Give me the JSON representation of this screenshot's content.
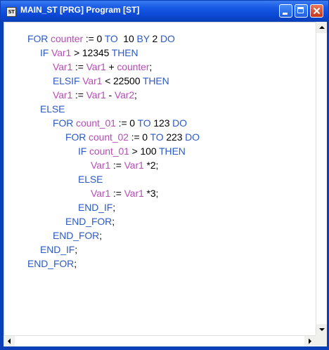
{
  "window": {
    "title": "MAIN_ST [PRG] Program [ST]",
    "icon_label": "ST",
    "icon": "st-program-icon",
    "controls": [
      "minimize-icon",
      "maximize-icon",
      "close-icon"
    ]
  },
  "colors": {
    "titlebar": "#0b47d4",
    "keyword": "#2c5ac4",
    "variable": "#b54eb5",
    "operator": "#000000",
    "close_button": "#c4371c"
  },
  "code": {
    "lines": [
      {
        "indent": 0,
        "tokens": [
          {
            "t": "kw",
            "v": "FOR "
          },
          {
            "t": "var",
            "v": "counter"
          },
          {
            "t": "op",
            "v": " := 0 "
          },
          {
            "t": "kw",
            "v": "TO"
          },
          {
            "t": "op",
            "v": "  10 "
          },
          {
            "t": "kw",
            "v": "BY"
          },
          {
            "t": "op",
            "v": " 2 "
          },
          {
            "t": "kw",
            "v": "DO"
          }
        ]
      },
      {
        "indent": 1,
        "tokens": [
          {
            "t": "kw",
            "v": "IF "
          },
          {
            "t": "var",
            "v": "Var1"
          },
          {
            "t": "op",
            "v": " > 12345 "
          },
          {
            "t": "kw",
            "v": "THEN"
          }
        ]
      },
      {
        "indent": 2,
        "tokens": [
          {
            "t": "var",
            "v": "Var1"
          },
          {
            "t": "op",
            "v": " := "
          },
          {
            "t": "var",
            "v": "Var1"
          },
          {
            "t": "op",
            "v": " + "
          },
          {
            "t": "var",
            "v": "counter"
          },
          {
            "t": "op",
            "v": ";"
          }
        ]
      },
      {
        "indent": 2,
        "tokens": [
          {
            "t": "kw",
            "v": "ELSIF "
          },
          {
            "t": "var",
            "v": "Var1"
          },
          {
            "t": "op",
            "v": " < 22500 "
          },
          {
            "t": "kw",
            "v": "THEN"
          }
        ]
      },
      {
        "indent": 2,
        "tokens": [
          {
            "t": "var",
            "v": "Var1"
          },
          {
            "t": "op",
            "v": " := "
          },
          {
            "t": "var",
            "v": "Var1"
          },
          {
            "t": "op",
            "v": " - "
          },
          {
            "t": "var",
            "v": "Var2"
          },
          {
            "t": "op",
            "v": ";"
          }
        ]
      },
      {
        "indent": 1,
        "tokens": [
          {
            "t": "kw",
            "v": "ELSE"
          }
        ]
      },
      {
        "indent": 2,
        "tokens": [
          {
            "t": "kw",
            "v": "FOR "
          },
          {
            "t": "var",
            "v": "count_01"
          },
          {
            "t": "op",
            "v": " := 0 "
          },
          {
            "t": "kw",
            "v": "TO"
          },
          {
            "t": "op",
            "v": " 123 "
          },
          {
            "t": "kw",
            "v": "DO"
          }
        ]
      },
      {
        "indent": 3,
        "tokens": [
          {
            "t": "kw",
            "v": "FOR "
          },
          {
            "t": "var",
            "v": "count_02"
          },
          {
            "t": "op",
            "v": " := 0 "
          },
          {
            "t": "kw",
            "v": "TO"
          },
          {
            "t": "op",
            "v": " 223 "
          },
          {
            "t": "kw",
            "v": "DO"
          }
        ]
      },
      {
        "indent": 4,
        "tokens": [
          {
            "t": "kw",
            "v": "IF "
          },
          {
            "t": "var",
            "v": "count_01"
          },
          {
            "t": "op",
            "v": " > 100 "
          },
          {
            "t": "kw",
            "v": "THEN"
          }
        ]
      },
      {
        "indent": 5,
        "tokens": [
          {
            "t": "var",
            "v": "Var1"
          },
          {
            "t": "op",
            "v": " := "
          },
          {
            "t": "var",
            "v": "Var1"
          },
          {
            "t": "op",
            "v": " *2;"
          }
        ]
      },
      {
        "indent": 4,
        "tokens": [
          {
            "t": "kw",
            "v": "ELSE"
          }
        ]
      },
      {
        "indent": 5,
        "tokens": [
          {
            "t": "var",
            "v": "Var1"
          },
          {
            "t": "op",
            "v": " := "
          },
          {
            "t": "var",
            "v": "Var1"
          },
          {
            "t": "op",
            "v": " *3;"
          }
        ]
      },
      {
        "indent": 4,
        "tokens": [
          {
            "t": "kw",
            "v": "END_IF"
          },
          {
            "t": "op",
            "v": ";"
          }
        ]
      },
      {
        "indent": 3,
        "tokens": [
          {
            "t": "kw",
            "v": "END_FOR"
          },
          {
            "t": "op",
            "v": ";"
          }
        ]
      },
      {
        "indent": 2,
        "tokens": [
          {
            "t": "kw",
            "v": "END_FOR"
          },
          {
            "t": "op",
            "v": ";"
          }
        ]
      },
      {
        "indent": 1,
        "tokens": [
          {
            "t": "kw",
            "v": "END_IF"
          },
          {
            "t": "op",
            "v": ";"
          }
        ]
      },
      {
        "indent": 0,
        "tokens": [
          {
            "t": "kw",
            "v": "END_FOR"
          },
          {
            "t": "op",
            "v": ";"
          }
        ]
      }
    ]
  },
  "scrollbars": {
    "vertical": {
      "up": "scroll-up-arrow-icon",
      "down": "scroll-down-arrow-icon"
    },
    "horizontal": {
      "left": "scroll-left-arrow-icon",
      "right": "scroll-right-arrow-icon"
    }
  }
}
